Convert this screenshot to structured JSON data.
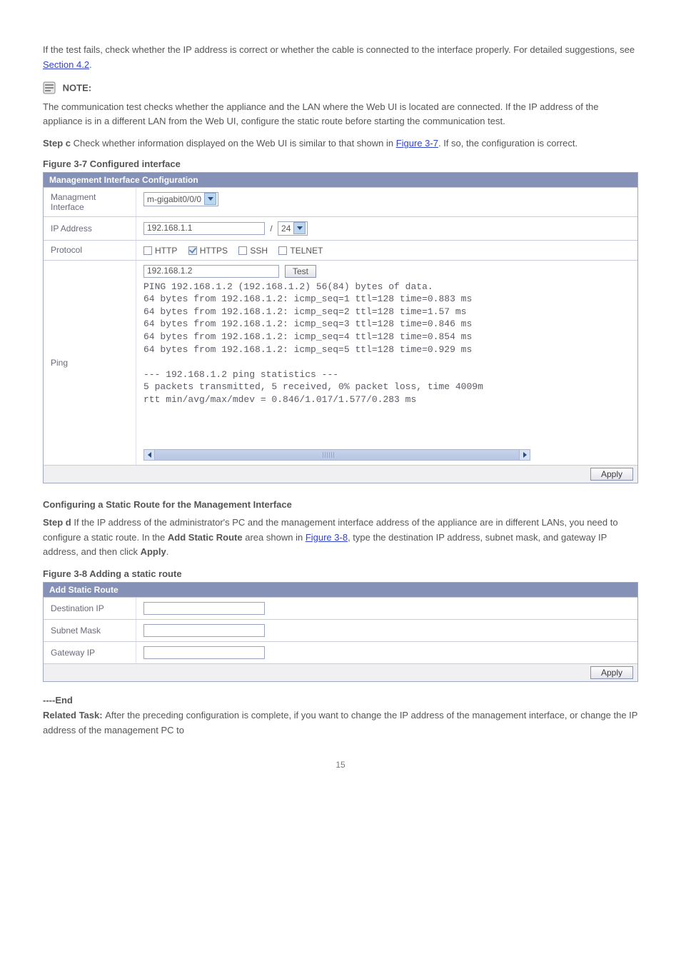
{
  "intro": {
    "text1_a": "If the test fails, check whether the IP address is correct or whether the cable is connected to the interface properly. For detailed suggestions, see ",
    "link1": "Section 4.2",
    "text1_b": ".",
    "note_label": "NOTE:",
    "note_text": "The communication test checks whether the appliance and the LAN where the Web UI is located are connected. If the IP address of the appliance is in a different LAN from the Web UI, configure the static route before starting the communication test.",
    "step_c_a": "Step c ",
    "step_c_b": "Check whether information displayed on the Web UI is similar to that shown in ",
    "link2": "Figure 3-7",
    "step_c_c": ". If so, the configuration is correct."
  },
  "fig7_caption": "Figure 3-7  Configured interface",
  "mgmt": {
    "title": "Management Interface Configuration",
    "label_interface": "Managment Interface",
    "select_interface": "m-gigabit0/0/0",
    "label_ip": "IP Address",
    "ip_value": "192.168.1.1",
    "mask_value": "24",
    "label_protocol": "Protocol",
    "proto": {
      "http": "HTTP",
      "https": "HTTPS",
      "ssh": "SSH",
      "telnet": "TELNET"
    },
    "label_ping": "Ping",
    "ping_ip": "192.168.1.2",
    "test_btn": "Test",
    "ping_output": "PING 192.168.1.2 (192.168.1.2) 56(84) bytes of data.\n64 bytes from 192.168.1.2: icmp_seq=1 ttl=128 time=0.883 ms\n64 bytes from 192.168.1.2: icmp_seq=2 ttl=128 time=1.57 ms\n64 bytes from 192.168.1.2: icmp_seq=3 ttl=128 time=0.846 ms\n64 bytes from 192.168.1.2: icmp_seq=4 ttl=128 time=0.854 ms\n64 bytes from 192.168.1.2: icmp_seq=5 ttl=128 time=0.929 ms\n\n--- 192.168.1.2 ping statistics ---\n5 packets transmitted, 5 received, 0% packet loss, time 4009m\nrtt min/avg/max/mdev = 0.846/1.017/1.577/0.283 ms",
    "apply": "Apply"
  },
  "static_section": {
    "heading": "Configuring a Static Route for the Management Interface",
    "step_d_label": "Step d ",
    "step_d_a": "If the IP address of the administrator's PC and the management interface address of the appliance are in different LANs, you need to configure a static route. In the ",
    "bold1": "Add Static Route",
    "step_d_b": " area shown in ",
    "link3": "Figure 3-8",
    "step_d_c": ", type the destination IP address, subnet mask, and gateway IP address, and then click ",
    "bold2": "Apply",
    "step_d_d": "."
  },
  "fig8_caption": "Figure 3-8  Adding a static route",
  "route": {
    "title": "Add Static Route",
    "label_dest": "Destination IP",
    "label_mask": "Subnet Mask",
    "label_gw": "Gateway IP",
    "dest_value": "",
    "mask_value": "",
    "gw_value": "",
    "apply": "Apply"
  },
  "tail": {
    "end": "----End",
    "related_label": "Related Task: ",
    "related_text": "After the preceding configuration is complete, if you want to change the IP address of the management interface, or change the IP address of the management PC to",
    "page_num": "15"
  }
}
